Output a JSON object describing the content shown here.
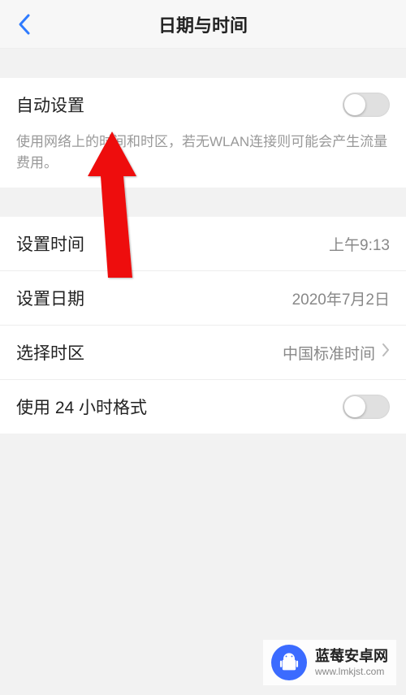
{
  "header": {
    "title": "日期与时间"
  },
  "auto": {
    "label": "自动设置",
    "desc": "使用网络上的时间和时区，若无WLAN连接则可能会产生流量费用。",
    "enabled": false
  },
  "time": {
    "label": "设置时间",
    "value": "上午9:13"
  },
  "date": {
    "label": "设置日期",
    "value": "2020年7月2日"
  },
  "timezone": {
    "label": "选择时区",
    "value": "中国标准时间"
  },
  "hour24": {
    "label": "使用 24 小时格式",
    "enabled": false
  },
  "watermark": {
    "name": "蓝莓安卓网",
    "url": "www.lmkjst.com"
  }
}
